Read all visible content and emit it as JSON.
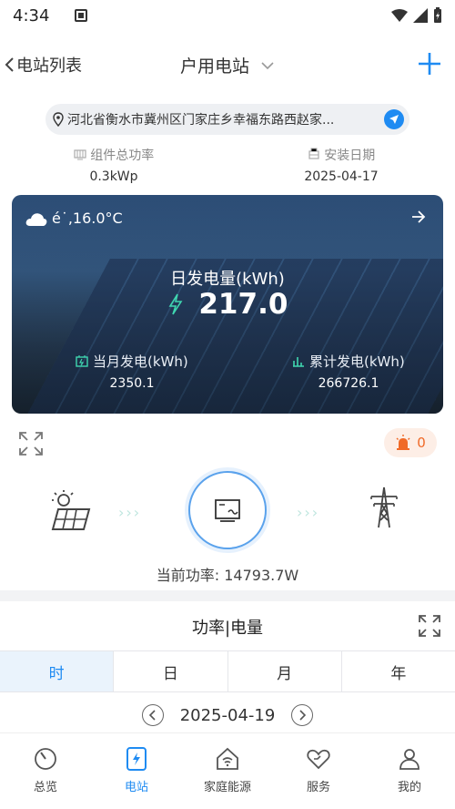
{
  "status_bar": {
    "time": "4:34"
  },
  "nav": {
    "back_label": "电站列表",
    "title": "户用电站"
  },
  "address": {
    "text": "河北省衡水市冀州区门家庄乡幸福东路西赵家..."
  },
  "info": [
    {
      "label": "组件总功率",
      "value": "0.3kWp"
    },
    {
      "label": "安装日期",
      "value": "2025-04-17"
    }
  ],
  "banner": {
    "weather": "é˙,16.0°C",
    "daily_label": "日发电量(kWh)",
    "daily_value": "217.0",
    "monthly_label": "当月发电(kWh)",
    "monthly_value": "2350.1",
    "total_label": "累计发电(kWh)",
    "total_value": "266726.1"
  },
  "alarm_count": "0",
  "flow": {
    "power_text": "当前功率: 14793.7W"
  },
  "chart_section": {
    "title": "功率|电量",
    "tabs": [
      "时",
      "日",
      "月",
      "年"
    ],
    "active_tab": 0,
    "date": "2025-04-19"
  },
  "bottom_nav": [
    "总览",
    "电站",
    "家庭能源",
    "服务",
    "我的"
  ],
  "colors": {
    "accent": "#1f8bf2",
    "alarm": "#f06a28"
  }
}
